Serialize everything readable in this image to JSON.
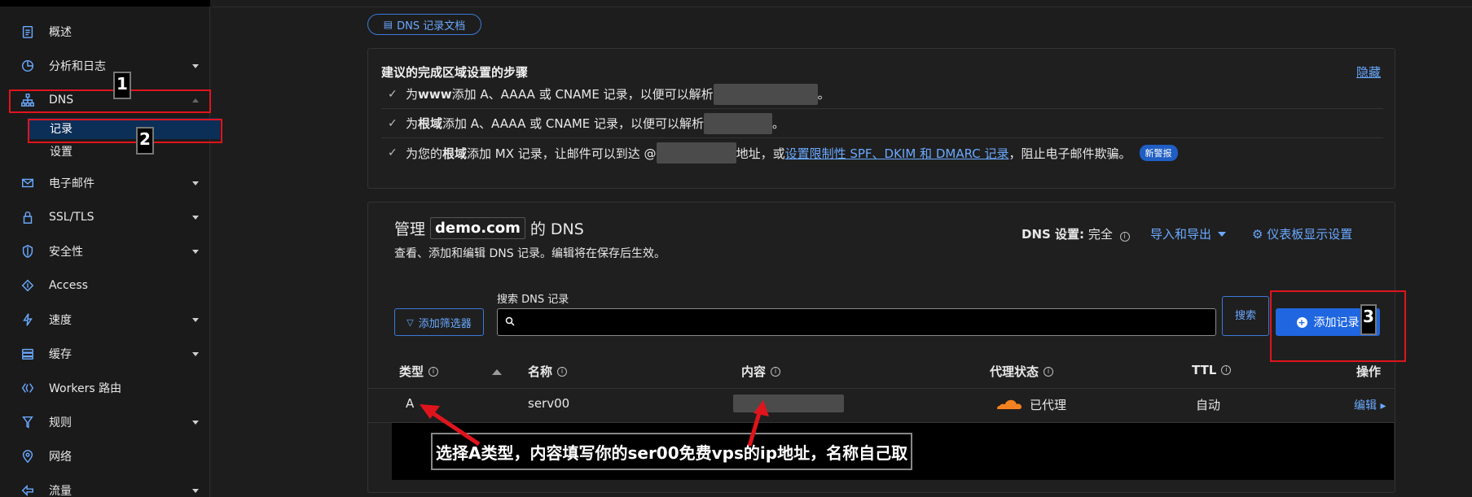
{
  "sidebar": {
    "items": [
      {
        "label": "概述",
        "icon": "clipboard-icon",
        "chevron": false
      },
      {
        "label": "分析和日志",
        "icon": "pie-chart-icon",
        "chevron": true
      },
      {
        "label": "DNS",
        "icon": "network-icon",
        "chevron": true
      },
      {
        "label": "电子邮件",
        "icon": "email-icon",
        "chevron": true
      },
      {
        "label": "SSL/TLS",
        "icon": "lock-icon",
        "chevron": true
      },
      {
        "label": "安全性",
        "icon": "shield-icon",
        "chevron": true
      },
      {
        "label": "Access",
        "icon": "access-icon",
        "chevron": false
      },
      {
        "label": "速度",
        "icon": "lightning-icon",
        "chevron": true
      },
      {
        "label": "缓存",
        "icon": "cache-icon",
        "chevron": true
      },
      {
        "label": "Workers 路由",
        "icon": "workers-icon",
        "chevron": false
      },
      {
        "label": "规则",
        "icon": "funnel-icon",
        "chevron": true
      },
      {
        "label": "网络",
        "icon": "location-icon",
        "chevron": false
      },
      {
        "label": "流量",
        "icon": "traffic-icon",
        "chevron": true
      }
    ],
    "dns_sub": [
      {
        "label": "记录",
        "active": true
      },
      {
        "label": "设置",
        "active": false
      }
    ]
  },
  "doc_link": "DNS 记录文档",
  "steps": {
    "title": "建议的完成区域设置的步骤",
    "hide": "隐藏",
    "items": [
      {
        "pre": "为 ",
        "bold": "www",
        "post": " 添加 A、AAAA 或 CNAME 记录，以便可以解析",
        "end": "。"
      },
      {
        "pre": "为",
        "bold": "根域",
        "post": "添加 A、AAAA 或 CNAME 记录，以便可以解析",
        "end": "。"
      },
      {
        "pre": "为您的",
        "bold": "根域",
        "post": "添加 MX 记录，让邮件可以到达 @",
        "mid": "地址，或",
        "link": "设置限制性 SPF、DKIM 和 DMARC 记录",
        "end": "，阻止电子邮件欺骗。",
        "badge": "新警报"
      }
    ]
  },
  "manage": {
    "prefix": "管理",
    "domain": "demo.com",
    "suffix": "的 DNS",
    "subtitle": "查看、添加和编辑 DNS 记录。编辑将在保存后生效。",
    "dns_setting_label": "DNS 设置:",
    "dns_setting_value": "完全",
    "import_export": "导入和导出",
    "dashboard_settings": "仪表板显示设置",
    "filter_button": "添加筛选器",
    "search_label": "搜索 DNS 记录",
    "search_placeholder": "",
    "search_button": "搜索",
    "add_button": "添加记录"
  },
  "table": {
    "headers": [
      "类型",
      "名称",
      "内容",
      "代理状态",
      "TTL",
      "操作"
    ],
    "rows": [
      {
        "type": "A",
        "name": "serv00",
        "content": "",
        "proxy": "已代理",
        "ttl": "自动",
        "action": "编辑"
      }
    ]
  },
  "annotations": {
    "markers": [
      "1",
      "2",
      "3"
    ],
    "caption": "选择A类型，内容填写你的ser00免费vps的ip地址，名称自己取",
    "color": "#e0141c"
  },
  "colors": {
    "accent": "#6aa9ff",
    "primary_button": "#1f66e0",
    "background": "#1d1d1d",
    "proxy_cloud": "#f48120"
  }
}
